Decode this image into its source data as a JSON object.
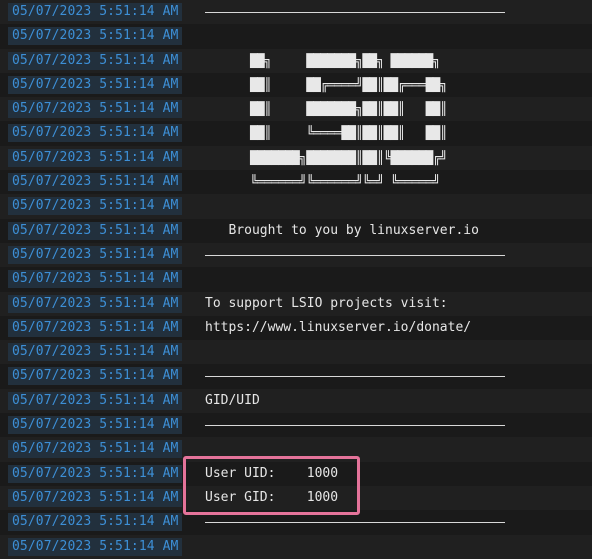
{
  "timestamp": "05/07/2023 5:51:14 AM",
  "logo_lines": [
    "██╗     ███████╗██╗ ██████╗",
    "██║     ██╔════╝██║██╔═══██╗",
    "██║     ███████╗██║██║   ██║",
    "██║     ╚════██║██║██║   ██║",
    "███████╗███████║██║╚██████╔╝",
    "╚══════╝╚══════╝╚═╝ ╚═════╝"
  ],
  "brought_by": "   Brought to you by linuxserver.io",
  "support_line": "To support LSIO projects visit:",
  "donate_url": "https://www.linuxserver.io/donate/",
  "gid_uid_header": "GID/UID",
  "user_uid": "User UID:    1000",
  "user_gid": "User GID:    1000"
}
